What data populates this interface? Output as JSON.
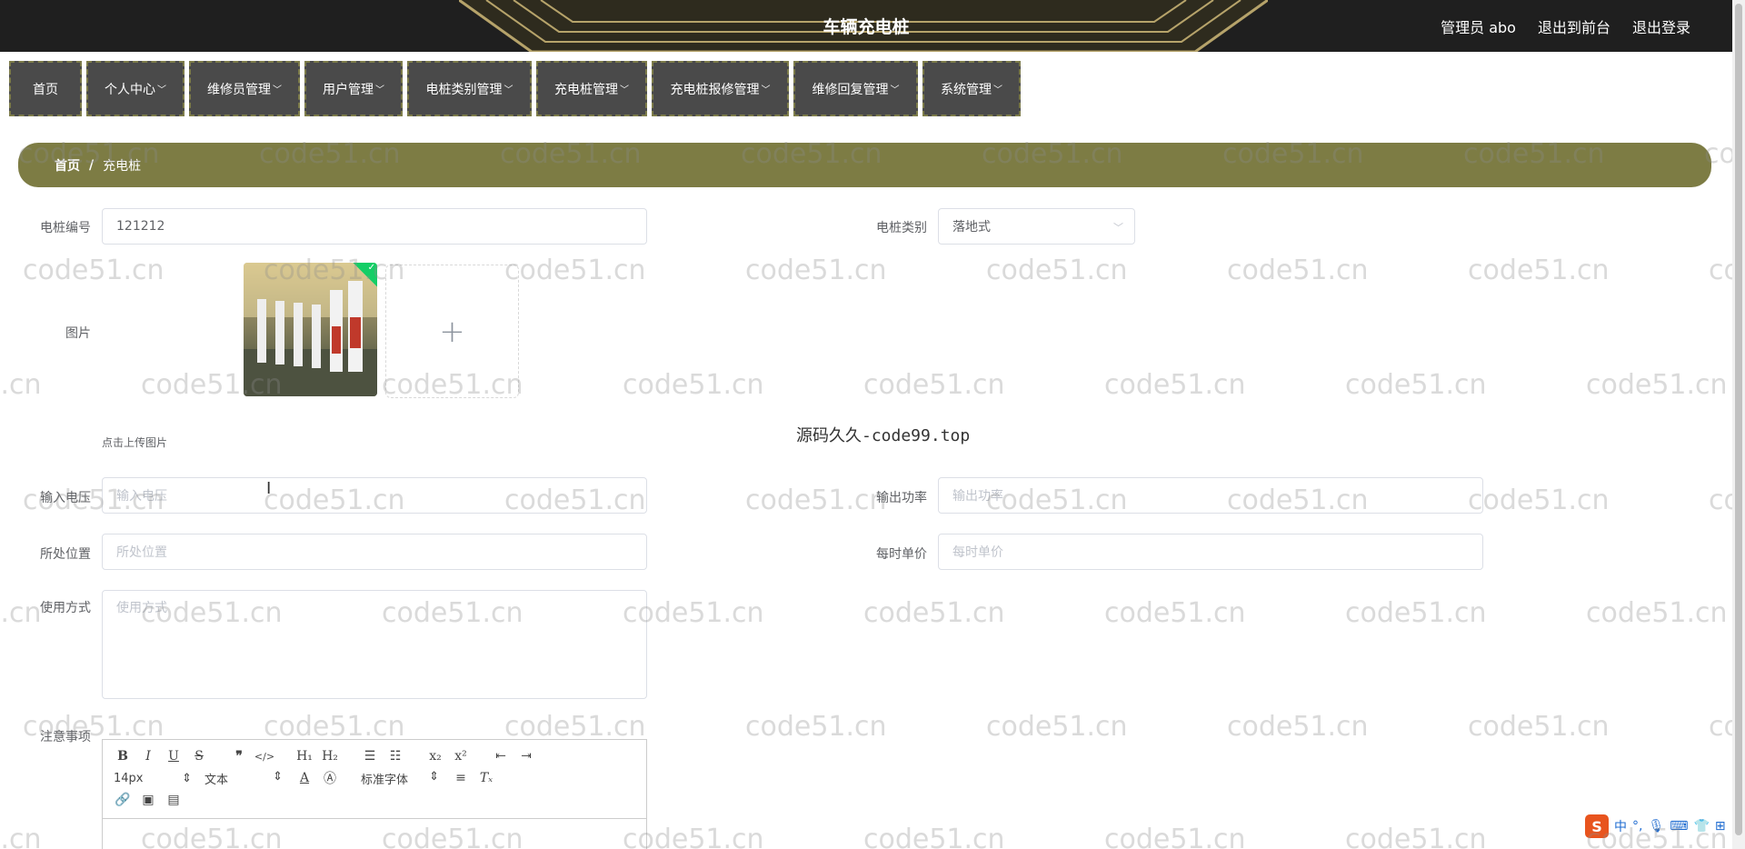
{
  "header": {
    "title": "车辆充电桩",
    "admin_label": "管理员 abo",
    "front_label": "退出到前台",
    "logout_label": "退出登录"
  },
  "nav": {
    "items": [
      {
        "label": "首页"
      },
      {
        "label": "个人中心"
      },
      {
        "label": "维修员管理"
      },
      {
        "label": "用户管理"
      },
      {
        "label": "电桩类别管理"
      },
      {
        "label": "充电桩管理"
      },
      {
        "label": "充电桩报修管理"
      },
      {
        "label": "维修回复管理"
      },
      {
        "label": "系统管理"
      }
    ]
  },
  "breadcrumb": {
    "home": "首页",
    "separator": "/",
    "current": "充电桩"
  },
  "watermark": {
    "text": "code51.cn",
    "overlay_text": "源码久久-code99.top"
  },
  "form": {
    "pile_number": {
      "label": "电桩编号",
      "value": "121212"
    },
    "pile_category": {
      "label": "电桩类别",
      "value": "落地式"
    },
    "image": {
      "label": "图片",
      "upload_tip": "点击上传图片",
      "plus": "+"
    },
    "input_voltage": {
      "label": "输入电压",
      "placeholder": "输入电压"
    },
    "output_power": {
      "label": "输出功率",
      "placeholder": "输出功率"
    },
    "location": {
      "label": "所处位置",
      "placeholder": "所处位置"
    },
    "unit_price": {
      "label": "每时单价",
      "placeholder": "每时单价"
    },
    "usage": {
      "label": "使用方式",
      "placeholder": "使用方式"
    },
    "notes": {
      "label": "注意事项"
    }
  },
  "editor": {
    "font_size": "14px",
    "header_select": "文本",
    "font_family": "标准字体"
  },
  "ime": {
    "logo": "S",
    "lang": "中"
  }
}
